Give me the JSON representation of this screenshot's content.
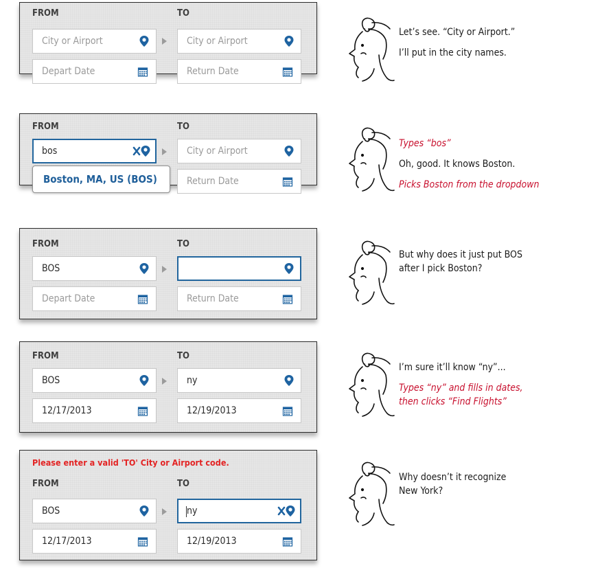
{
  "colors": {
    "accent": "#21659d",
    "error": "#e32424",
    "annotation": "#c8102e"
  },
  "panels": [
    {
      "from_label": "FROM",
      "to_label": "TO",
      "from_field": {
        "placeholder": "City or Airport",
        "icon": "map-pin-icon"
      },
      "to_field": {
        "placeholder": "City or Airport",
        "icon": "map-pin-icon"
      },
      "depart_field": {
        "placeholder": "Depart Date",
        "icon": "calendar-icon"
      },
      "return_field": {
        "placeholder": "Return Date",
        "icon": "calendar-icon"
      }
    },
    {
      "from_label": "FROM",
      "to_label": "TO",
      "from_field": {
        "value": "bos",
        "icon": "clear-x-icon"
      },
      "to_field": {
        "placeholder": "City or Airport",
        "icon": "map-pin-icon"
      },
      "dropdown_option": "Boston, MA, US (BOS)",
      "return_field": {
        "placeholder": "Return Date",
        "icon": "calendar-icon"
      }
    },
    {
      "from_label": "FROM",
      "to_label": "TO",
      "from_field": {
        "value": "BOS",
        "icon": "map-pin-icon"
      },
      "to_field": {
        "value": "",
        "icon": "map-pin-icon"
      },
      "depart_field": {
        "placeholder": "Depart Date",
        "icon": "calendar-icon"
      },
      "return_field": {
        "placeholder": "Return Date",
        "icon": "calendar-icon"
      }
    },
    {
      "from_label": "FROM",
      "to_label": "TO",
      "from_field": {
        "value": "BOS",
        "icon": "map-pin-icon"
      },
      "to_field": {
        "value": "ny",
        "icon": "map-pin-icon"
      },
      "depart_field": {
        "value": "12/17/2013",
        "icon": "calendar-icon"
      },
      "return_field": {
        "value": "12/19/2013",
        "icon": "calendar-icon"
      }
    },
    {
      "error_message": "Please enter a valid 'TO' City or Airport code.",
      "from_label": "FROM",
      "to_label": "TO",
      "from_field": {
        "value": "BOS",
        "icon": "map-pin-icon"
      },
      "to_field": {
        "value": "ny",
        "icon": "clear-x-icon"
      },
      "depart_field": {
        "value": "12/17/2013",
        "icon": "calendar-icon"
      },
      "return_field": {
        "value": "12/19/2013",
        "icon": "calendar-icon"
      }
    }
  ],
  "captions": [
    {
      "lines": [
        "Let’s see. “City or Airport.”",
        "I’ll put in the city names."
      ]
    },
    {
      "action": "Types “bos”",
      "line": "Oh, good. It knows Boston.",
      "action2": "Picks Boston from the dropdown"
    },
    {
      "lines": [
        "But why does it just put BOS",
        "after I pick Boston?"
      ]
    },
    {
      "line": "I’m sure it’ll know “ny”...",
      "action_lines": [
        "Types “ny” and fills in dates,",
        "then clicks “Find Flights”"
      ]
    },
    {
      "lines": [
        "Why doesn’t it recognize",
        "New York?"
      ]
    }
  ]
}
